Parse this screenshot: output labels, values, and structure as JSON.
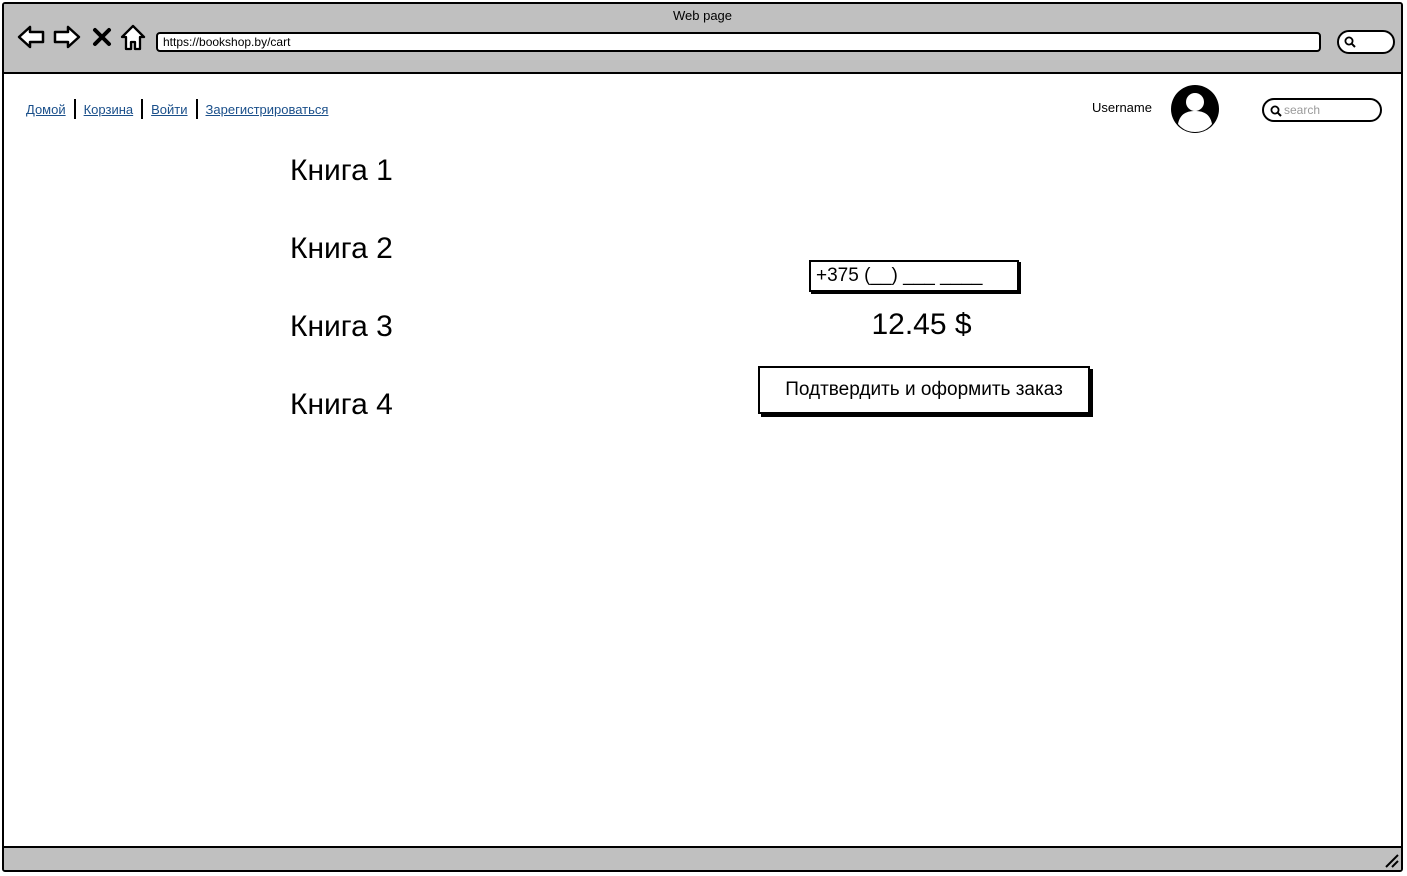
{
  "window": {
    "title": "Web page"
  },
  "browser": {
    "url": "https://bookshop.by/cart"
  },
  "nav": {
    "links": [
      "Домой",
      "Корзина",
      "Войти",
      "Зарегистрироваться"
    ]
  },
  "user": {
    "name": "Username"
  },
  "search": {
    "placeholder": "search"
  },
  "cart": {
    "books": [
      "Книга 1",
      "Книга 2",
      "Книга 3",
      "Книга 4"
    ],
    "phone_value": "+375 (__) ___ ____",
    "total": "12.45 $",
    "confirm_label": "Подтвердить и оформить заказ"
  },
  "icons": {
    "back": "arrow-left-icon",
    "forward": "arrow-right-icon",
    "stop": "close-icon",
    "home": "home-icon",
    "search": "search-icon",
    "avatar": "user-avatar-icon",
    "resize": "resize-grip-icon"
  },
  "colors": {
    "chrome": "#c0c0c0",
    "link": "#1a4f8a"
  }
}
